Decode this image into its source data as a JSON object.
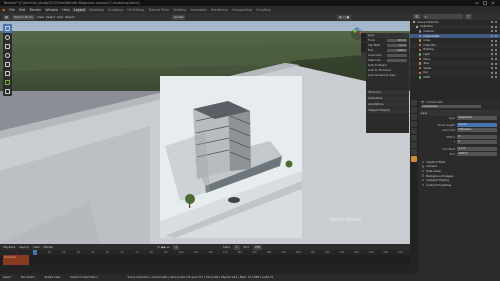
{
  "window": {
    "title": "Blender* [F:\\Archive\\_studio2017\\Files\\Blender Beginners course\\17-rendering.blend]"
  },
  "menubar": {
    "items": [
      "File",
      "Edit",
      "Render",
      "Window",
      "Help"
    ],
    "workspaces": [
      "Layout",
      "Modeling",
      "Sculpting",
      "UV Editing",
      "Texture Paint",
      "Shading",
      "Animation",
      "Rendering",
      "Compositing",
      "Scripting"
    ],
    "active_workspace": "Layout"
  },
  "viewport_header": {
    "mode": "Object Mode",
    "menus": [
      "View",
      "Select",
      "Add",
      "Object"
    ],
    "orientation": "Global"
  },
  "npanel": {
    "section": "Lens",
    "rows": [
      {
        "label": "Focal",
        "value": "50 mm"
      },
      {
        "label": "Clip Start",
        "value": "0.1 m"
      },
      {
        "label": "End",
        "value": "1000 m"
      },
      {
        "label": "Local Cam",
        "value": ""
      },
      {
        "label": "View Lock",
        "value": ""
      }
    ],
    "sub_sections": [
      "3D Cursor",
      "Collections",
      "Annotations",
      "Viewport Display"
    ],
    "checks": [
      "Lock to Object",
      "Lock to 3D Cursor",
      "Lock Camera to View"
    ]
  },
  "viewport_overlay_text": "Middle Mouse",
  "timeline": {
    "menus": [
      "Playback",
      "Keying",
      "View",
      "Marker"
    ],
    "frame_current": "1",
    "start_label": "Start",
    "start": "1",
    "end_label": "End",
    "end": "250",
    "ruler_ticks": [
      "0",
      "10",
      "20",
      "30",
      "40",
      "50",
      "60",
      "70",
      "80",
      "90",
      "100",
      "110",
      "120",
      "130",
      "140",
      "150",
      "160",
      "170",
      "180",
      "190",
      "200",
      "210",
      "220",
      "230",
      "240",
      "250"
    ],
    "track_label": "Summary"
  },
  "outliner": {
    "search_placeholder": "",
    "rows": [
      {
        "label": "Scene Collection",
        "color": "#cfcfcf",
        "selected": false
      },
      {
        "label": "Collection",
        "color": "#cfcfcf",
        "selected": false
      },
      {
        "label": "Camera",
        "color": "#9b7ddb",
        "selected": false
      },
      {
        "label": "Camera.001",
        "color": "#9b7ddb",
        "selected": true
      },
      {
        "label": "Cube",
        "color": "#e08a3c",
        "selected": false
      },
      {
        "label": "Cube.001",
        "color": "#e08a3c",
        "selected": false
      },
      {
        "label": "Building",
        "color": "#e08a3c",
        "selected": false
      },
      {
        "label": "Light",
        "color": "#5eb35e",
        "selected": false
      },
      {
        "label": "Plane",
        "color": "#e08a3c",
        "selected": false
      },
      {
        "label": "Tree",
        "color": "#e08a3c",
        "selected": false
      },
      {
        "label": "Street",
        "color": "#e08a3c",
        "selected": false
      },
      {
        "label": "Car",
        "color": "#e08a3c",
        "selected": false
      },
      {
        "label": "HDRI",
        "color": "#5eb35e",
        "selected": false
      }
    ]
  },
  "properties": {
    "object_name": "Camera.001",
    "data_name": "Camera.001",
    "sections": {
      "lens": "Lens",
      "type_label": "Type",
      "type_value": "Perspective",
      "focal_label": "Focal Length",
      "focal_value": "50 mm",
      "units_label": "Lens Unit",
      "units_value": "Millimeters",
      "shiftx_label": "Shift X",
      "shiftx_value": "0",
      "shifty_label": "Y",
      "shifty_value": "0",
      "clipstart_label": "Clip Start",
      "clipstart_value": "0.1 m",
      "clipend_label": "End",
      "clipend_value": "1000 m"
    },
    "collapsed": [
      "Depth of Field",
      "Camera",
      "Safe Areas",
      "Background Images",
      "Viewport Display",
      "Custom Properties"
    ]
  },
  "statusbar": {
    "items": [
      "Select",
      "Box Select",
      "Rotate View",
      "Object Context Menu"
    ],
    "stats": "Scene Collection | Camera.001 | Verts:2,416 | Faces:2,273 | Tris:4,546 | Objects:1/12 | Mem: 51.3 MiB | v2.80.75"
  },
  "colors": {
    "accent": "#4772b3",
    "selection": "#3f5a84",
    "keyframe_track": "#8a3a20",
    "active_tab": "#d28c3c"
  }
}
